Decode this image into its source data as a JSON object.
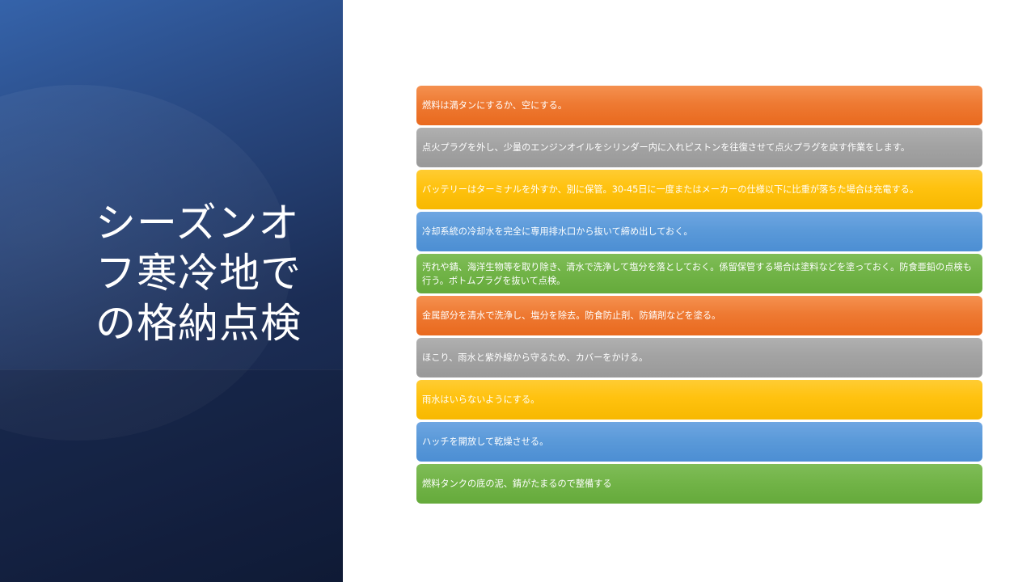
{
  "slide": {
    "title": "シーズンオ\nフ寒冷地で\nの格納点検"
  },
  "items": [
    {
      "text": "燃料は満タンにするか、空にする。",
      "color": "orange"
    },
    {
      "text": "点火プラグを外し、少量のエンジンオイルをシリンダー内に入れピストンを往復させて点火プラグを戻す作業をします。",
      "color": "gray"
    },
    {
      "text": "バッテリーはターミナルを外すか、別に保管。30-45日に一度またはメーカーの仕様以下に比重が落ちた場合は充電する。",
      "color": "gold"
    },
    {
      "text": "冷却系統の冷却水を完全に専用排水口から抜いて締め出しておく。",
      "color": "blue"
    },
    {
      "text": "汚れや錆、海洋生物等を取り除き、清水で洗浄して塩分を落としておく。係留保管する場合は塗料などを塗っておく。防食亜鉛の点検も行う。ボトムプラグを抜いて点検。",
      "color": "green"
    },
    {
      "text": "金属部分を清水で洗浄し、塩分を除去。防食防止剤、防錆剤などを塗る。",
      "color": "orange"
    },
    {
      "text": "ほこり、雨水と紫外線から守るため、カバーをかける。",
      "color": "gray"
    },
    {
      "text": "雨水はいらないようにする。",
      "color": "gold"
    },
    {
      "text": "ハッチを開放して乾燥させる。",
      "color": "blue"
    },
    {
      "text": "燃料タンクの底の泥、錆がたまるので整備する",
      "color": "green"
    }
  ],
  "colors": {
    "orange": "#ee7a33",
    "gray": "#a3a3a3",
    "gold": "#ffc20f",
    "blue": "#5b9ad9",
    "green": "#72b448",
    "panel": "#1b2d55"
  }
}
